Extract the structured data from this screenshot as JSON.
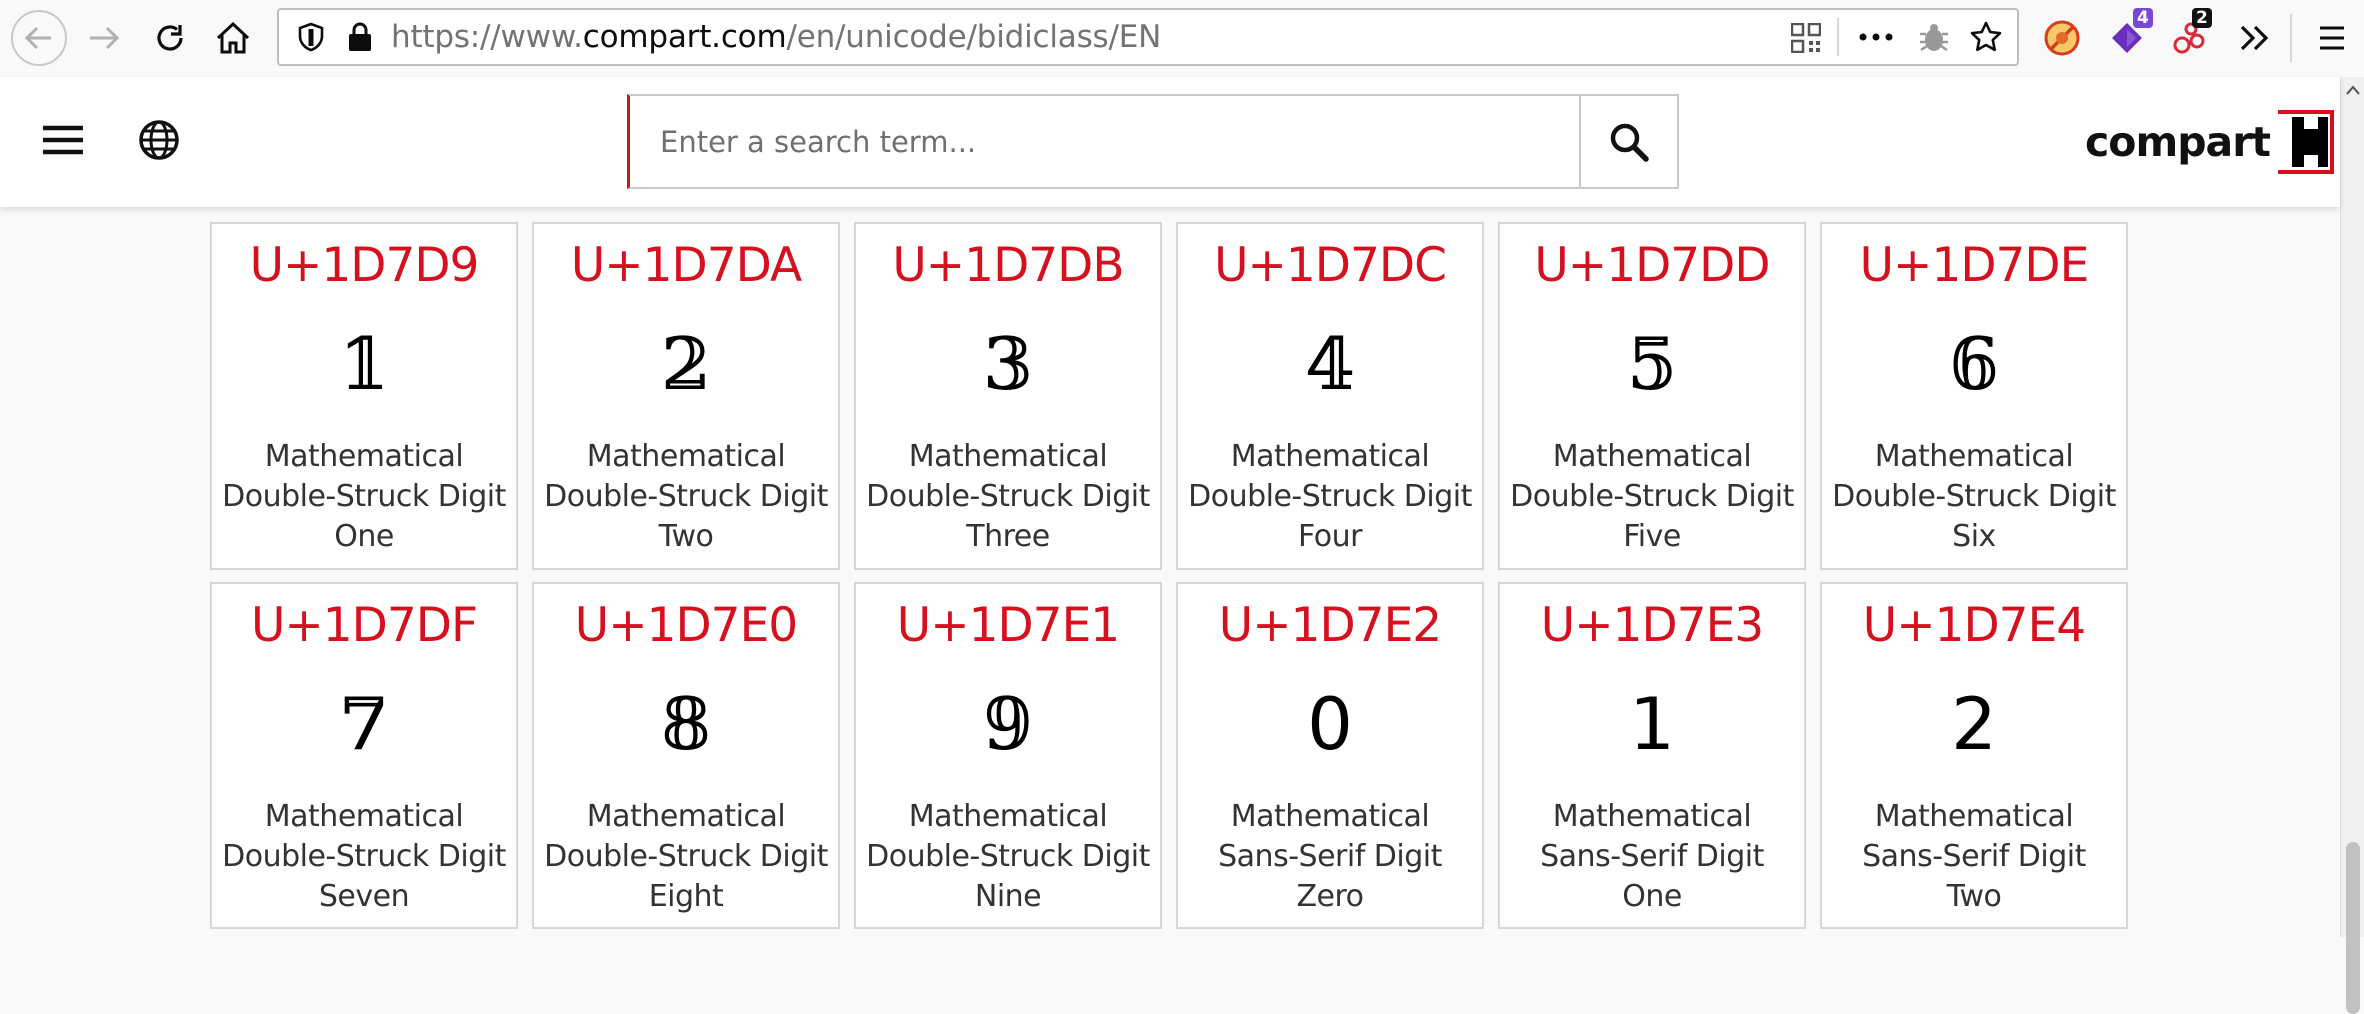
{
  "browser": {
    "url_prefix": "https://www.",
    "url_host": "compart.com",
    "url_path": "/en/unicode/bidiclass/EN",
    "extension_badge_1": "4",
    "extension_badge_2": "2"
  },
  "header": {
    "search_placeholder": "Enter a search term...",
    "logo_text": "compart"
  },
  "cards": [
    {
      "code": "U+1D7D9",
      "glyph": "𝟙",
      "name": "Mathematical Double-Struck Digit One"
    },
    {
      "code": "U+1D7DA",
      "glyph": "𝟚",
      "name": "Mathematical Double-Struck Digit Two"
    },
    {
      "code": "U+1D7DB",
      "glyph": "𝟛",
      "name": "Mathematical Double-Struck Digit Three"
    },
    {
      "code": "U+1D7DC",
      "glyph": "𝟜",
      "name": "Mathematical Double-Struck Digit Four"
    },
    {
      "code": "U+1D7DD",
      "glyph": "𝟝",
      "name": "Mathematical Double-Struck Digit Five"
    },
    {
      "code": "U+1D7DE",
      "glyph": "𝟞",
      "name": "Mathematical Double-Struck Digit Six"
    },
    {
      "code": "U+1D7DF",
      "glyph": "𝟟",
      "name": "Mathematical Double-Struck Digit Seven"
    },
    {
      "code": "U+1D7E0",
      "glyph": "𝟠",
      "name": "Mathematical Double-Struck Digit Eight"
    },
    {
      "code": "U+1D7E1",
      "glyph": "𝟡",
      "name": "Mathematical Double-Struck Digit Nine"
    },
    {
      "code": "U+1D7E2",
      "glyph": "𝟢",
      "name": "Mathematical Sans-Serif Digit Zero"
    },
    {
      "code": "U+1D7E3",
      "glyph": "𝟣",
      "name": "Mathematical Sans-Serif Digit One"
    },
    {
      "code": "U+1D7E4",
      "glyph": "𝟤",
      "name": "Mathematical Sans-Serif Digit Two"
    }
  ],
  "colors": {
    "accent": "#d6111e",
    "card_border": "#d6d6d6"
  }
}
